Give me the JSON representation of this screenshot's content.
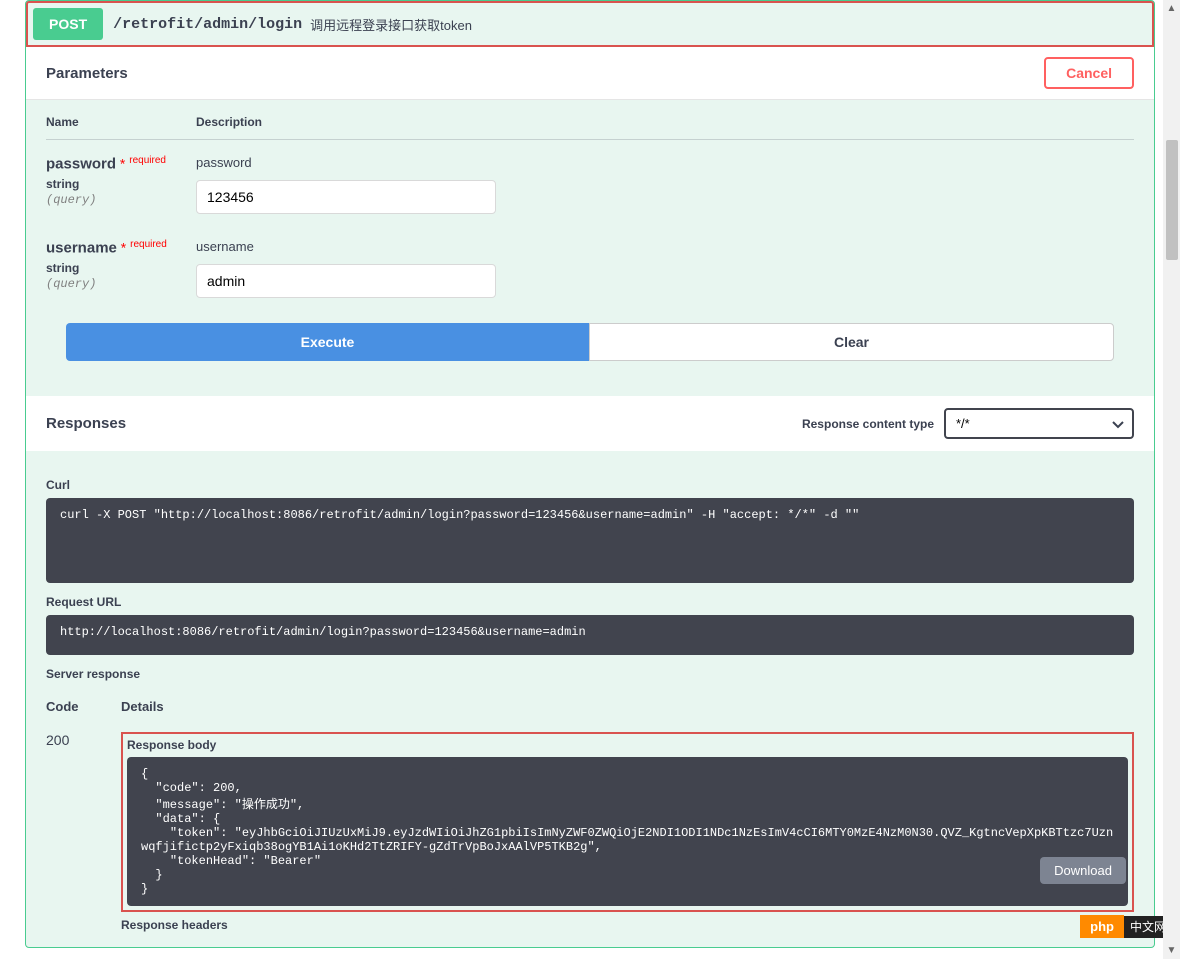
{
  "operation": {
    "method": "POST",
    "path": "/retrofit/admin/login",
    "summary": "调用远程登录接口获取token"
  },
  "parameters_section": {
    "title": "Parameters",
    "cancel_label": "Cancel",
    "col_name": "Name",
    "col_description": "Description",
    "required_marker": "*",
    "required_label": "required"
  },
  "parameters": [
    {
      "name": "password",
      "type": "string",
      "in": "(query)",
      "description": "password",
      "value": "123456"
    },
    {
      "name": "username",
      "type": "string",
      "in": "(query)",
      "description": "username",
      "value": "admin"
    }
  ],
  "actions": {
    "execute": "Execute",
    "clear": "Clear"
  },
  "responses": {
    "title": "Responses",
    "content_type_label": "Response content type",
    "content_type_value": "*/*",
    "curl_label": "Curl",
    "curl_value": "curl -X POST \"http://localhost:8086/retrofit/admin/login?password=123456&username=admin\" -H \"accept: */*\" -d \"\"",
    "request_url_label": "Request URL",
    "request_url_value": "http://localhost:8086/retrofit/admin/login?password=123456&username=admin",
    "server_response_label": "Server response",
    "code_label": "Code",
    "details_label": "Details",
    "code_value": "200",
    "response_body_label": "Response body",
    "response_body_value": "{\n  \"code\": 200,\n  \"message\": \"操作成功\",\n  \"data\": {\n    \"token\": \"eyJhbGciOiJIUzUxMiJ9.eyJzdWIiOiJhZG1pbiIsImNyZWF0ZWQiOjE2NDI1ODI1NDc1NzEsImV4cCI6MTY0MzE4NzM0N30.QVZ_KgtncVepXpKBTtzc7Uznwqfjifictp2yFxiqb38ogYB1Ai1oKHd2TtZRIFY-gZdTrVpBoJxAAlVP5TKB2g\",\n    \"tokenHead\": \"Bearer\"\n  }\n}",
    "download_label": "Download",
    "response_headers_label": "Response headers"
  },
  "watermark": {
    "php": "php",
    "cn": "中文网"
  }
}
